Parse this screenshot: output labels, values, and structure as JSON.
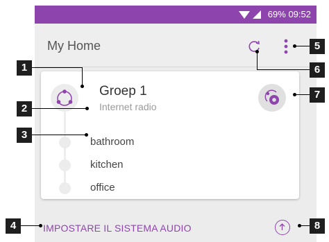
{
  "status_bar": {
    "battery": "69%",
    "time": "09:52"
  },
  "app_bar": {
    "title": "My Home",
    "refresh_icon": "refresh-icon",
    "menu_icon": "more-vertical-icon"
  },
  "group": {
    "name": "Groep 1",
    "source": "Internet radio",
    "rooms": [
      "bathroom",
      "kitchen",
      "office"
    ]
  },
  "bottom": {
    "setup_label": "IMPOSTARE IL SISTEMA AUDIO",
    "upload_icon": "arrow-up-circle-icon"
  },
  "callouts": [
    "1",
    "2",
    "3",
    "4",
    "5",
    "6",
    "7",
    "8"
  ],
  "colors": {
    "accent": "#8e44ad",
    "background": "#ececec",
    "card": "#ffffff"
  }
}
